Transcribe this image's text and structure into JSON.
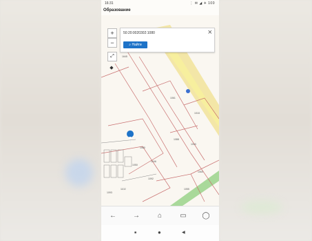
{
  "status_bar": {
    "time": "16:31",
    "icons": "⋮ ✉ ◢ ✈ 100"
  },
  "app": {
    "title": "Образование"
  },
  "search": {
    "query": "50:20:0020302:1080",
    "close_icon": "close-icon",
    "button_label": "Найти"
  },
  "map": {
    "zoom_in": "+",
    "zoom_out": "−",
    "parcel_labels": [
      "1645",
      "1061",
      "1080",
      "1088",
      "1046",
      "1018",
      "1040",
      "1050",
      "1102",
      "1092",
      "1060",
      "1055",
      "1093"
    ],
    "marker_icon": "map-pin-icon",
    "colors": {
      "road_yellow": "#f1e39a",
      "road_green": "#a9d99a",
      "parcel_red": "#c86f6f",
      "marker": "#1e73c8"
    }
  },
  "bottom_nav": {
    "items": [
      {
        "name": "back",
        "icon": "arrow-left-icon",
        "glyph": "←"
      },
      {
        "name": "forward",
        "icon": "arrow-right-icon",
        "glyph": "→"
      },
      {
        "name": "home",
        "icon": "home-icon",
        "glyph": "⌂"
      },
      {
        "name": "tabs",
        "icon": "tabs-icon",
        "glyph": "▭"
      },
      {
        "name": "profile",
        "icon": "profile-icon",
        "glyph": "◯"
      }
    ]
  },
  "system_nav": {
    "items": [
      {
        "name": "recents",
        "glyph": "■"
      },
      {
        "name": "home",
        "glyph": "●"
      },
      {
        "name": "back",
        "glyph": "◀"
      }
    ]
  }
}
